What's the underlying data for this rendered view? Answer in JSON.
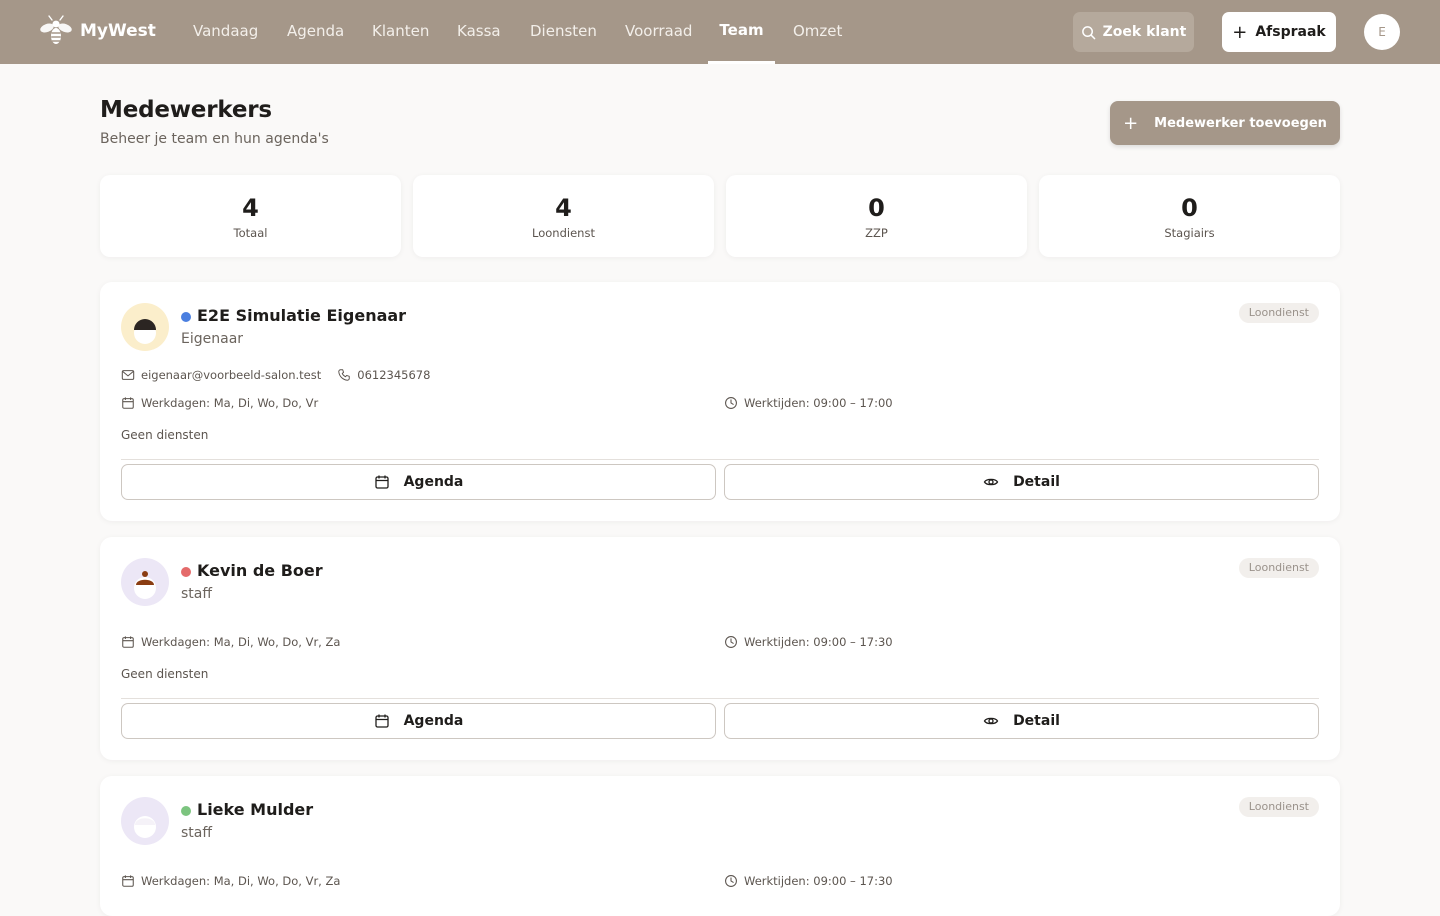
{
  "app": {
    "name": "MyWest"
  },
  "nav": [
    {
      "label": "Vandaag"
    },
    {
      "label": "Agenda"
    },
    {
      "label": "Klanten"
    },
    {
      "label": "Kassa"
    },
    {
      "label": "Diensten"
    },
    {
      "label": "Voorraad"
    },
    {
      "label": "Team",
      "active": true
    },
    {
      "label": "Omzet"
    }
  ],
  "header": {
    "search_label": "Zoek klant",
    "appointment_label": "Afspraak",
    "user_initial": "E"
  },
  "page": {
    "title": "Medewerkers",
    "subtitle": "Beheer je team en hun agenda's",
    "add_label": "Medewerker toevoegen"
  },
  "stats": [
    {
      "value": "4",
      "label": "Totaal"
    },
    {
      "value": "4",
      "label": "Loondienst"
    },
    {
      "value": "0",
      "label": "ZZP"
    },
    {
      "value": "0",
      "label": "Stagiairs"
    }
  ],
  "staff": [
    {
      "name": "E2E Simulatie Eigenaar",
      "role": "Eigenaar",
      "contract": "Loondienst",
      "status_color": "#4a7fe0",
      "avatar_bg": "#fbeecb",
      "email": "eigenaar@voorbeeld-salon.test",
      "phone": "0612345678",
      "workdays": "Werkdagen: Ma, Di, Wo, Do, Vr",
      "hours": "Werktijden: 09:00 – 17:00",
      "services": "Geen diensten",
      "agenda_label": "Agenda",
      "detail_label": "Detail"
    },
    {
      "name": "Kevin de Boer",
      "role": "staff",
      "contract": "Loondienst",
      "status_color": "#e46a6a",
      "avatar_bg": "#ece7f6",
      "workdays": "Werkdagen: Ma, Di, Wo, Do, Vr, Za",
      "hours": "Werktijden: 09:00 – 17:30",
      "services": "Geen diensten",
      "agenda_label": "Agenda",
      "detail_label": "Detail"
    },
    {
      "name": "Lieke Mulder",
      "role": "staff",
      "contract": "Loondienst",
      "status_color": "#7cc47f",
      "avatar_bg": "#ece7f6",
      "workdays": "Werkdagen: Ma, Di, Wo, Do, Vr, Za",
      "hours": "Werktijden: 09:00 – 17:30"
    }
  ],
  "icons": {
    "logo": "bee-logo-icon",
    "search": "search-icon",
    "plus": "plus-icon",
    "mail": "mail-icon",
    "phone": "phone-icon",
    "calendar": "calendar-icon",
    "clock": "clock-icon",
    "eye": "eye-icon"
  }
}
